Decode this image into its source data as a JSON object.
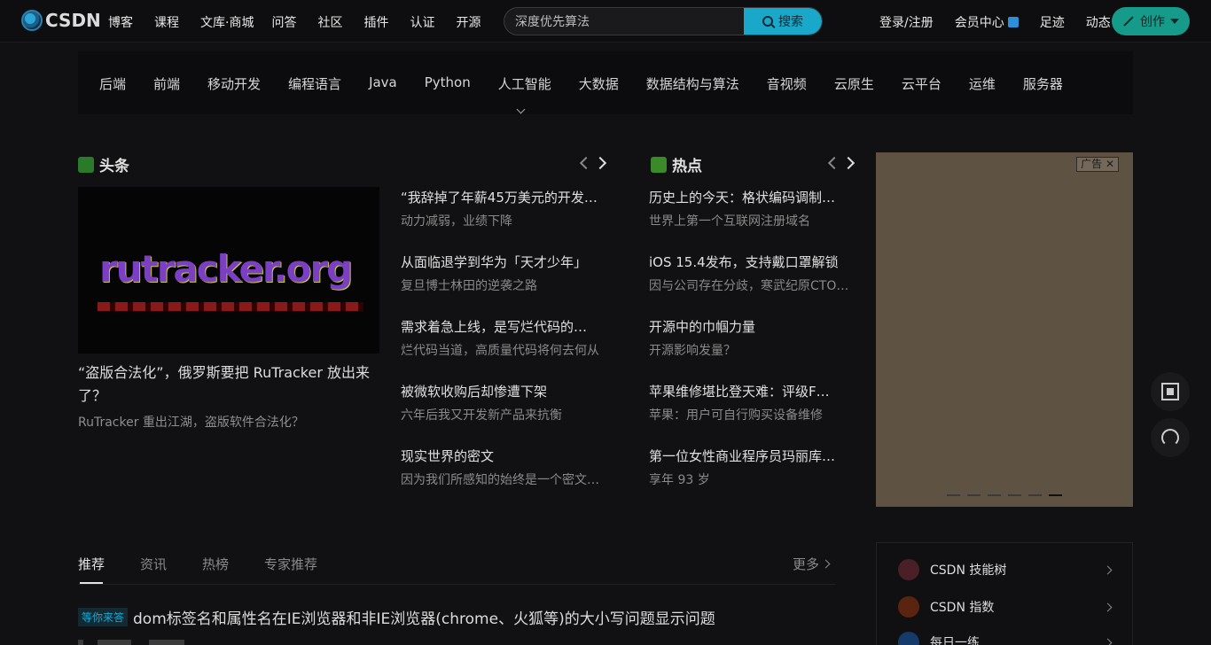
{
  "header": {
    "logo_text": "CSDN",
    "nav": [
      "博客",
      "课程",
      "文库·商城",
      "问答",
      "社区",
      "插件",
      "认证",
      "开源"
    ],
    "search_value": "深度优先算法",
    "search_button": "搜索",
    "login": "登录/注册",
    "vip": "会员中心",
    "footprint": "足迹",
    "dynamic": "动态",
    "create": "创作"
  },
  "categories": [
    "后端",
    "前端",
    "移动开发",
    "编程语言",
    "Java",
    "Python",
    "人工智能",
    "大数据",
    "数据结构与算法",
    "音视频",
    "云原生",
    "云平台",
    "运维",
    "服务器"
  ],
  "headline": {
    "title": "头条",
    "hero_logo": "rutracker.org",
    "hero_title": "“盗版合法化”，俄罗斯要把 RuTracker 放出来了？",
    "hero_sub": "RuTracker 重出江湖，盗版软件合法化？",
    "items": [
      {
        "t": "“我辞掉了年薪45万美元的开发…",
        "s": "动力减弱，业绩下降"
      },
      {
        "t": "从面临退学到华为「天才少年」",
        "s": "复旦博士林田的逆袭之路"
      },
      {
        "t": "需求着急上线，是写烂代码的…",
        "s": "烂代码当道，高质量代码将何去何从"
      },
      {
        "t": "被微软收购后却惨遭下架",
        "s": "六年后我又开发新产品来抗衡"
      },
      {
        "t": "现实世界的密文",
        "s": "因为我们所感知的始终是一个密文…"
      }
    ]
  },
  "hot": {
    "title": "热点",
    "items": [
      {
        "t": "历史上的今天：格状编码调制…",
        "s": "世界上第一个互联网注册域名"
      },
      {
        "t": "iOS 15.4发布，支持戴口罩解锁",
        "s": "因与公司存在分歧，寒武纪原CTO…"
      },
      {
        "t": "开源中的巾帼力量",
        "s": "开源影响发量？"
      },
      {
        "t": "苹果维修堪比登天难：评级F…",
        "s": "苹果：用户可自行购买设备维修"
      },
      {
        "t": "第一位女性商业程序员玛丽库…",
        "s": "享年 93 岁"
      }
    ]
  },
  "ad": {
    "tag": "广告",
    "dots": 6,
    "active_dot": 5
  },
  "feed": {
    "tabs": [
      "推荐",
      "资讯",
      "热榜",
      "专家推荐"
    ],
    "more": "更多",
    "badge": "等你来答",
    "title": "dom标签名和属性名在IE浏览器和非IE浏览器(chrome、火狐等)的大小写问题显示问题"
  },
  "sidebar": {
    "rows": [
      {
        "label": "CSDN 技能树",
        "color": "#8a2d3c"
      },
      {
        "label": "CSDN 指数",
        "color": "#c04a1a"
      },
      {
        "label": "每日一练",
        "color": "#1a6ac0"
      }
    ]
  },
  "colors": {
    "accent": "#19a8c9",
    "create": "#169a8a",
    "ad_bg": "#5e5242"
  }
}
